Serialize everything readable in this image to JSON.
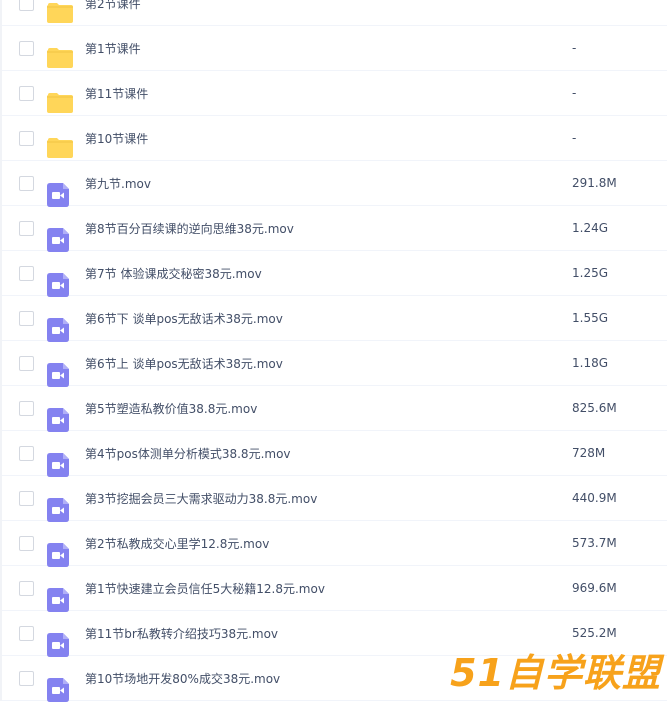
{
  "files": [
    {
      "name": "第2节课件",
      "type": "folder",
      "size": ""
    },
    {
      "name": "第1节课件",
      "type": "folder",
      "size": "-"
    },
    {
      "name": "第11节课件",
      "type": "folder",
      "size": "-"
    },
    {
      "name": "第10节课件",
      "type": "folder",
      "size": "-"
    },
    {
      "name": "第九节.mov",
      "type": "video",
      "size": "291.8M"
    },
    {
      "name": "第8节百分百续课的逆向思维38元.mov",
      "type": "video",
      "size": "1.24G"
    },
    {
      "name": "第7节 体验课成交秘密38元.mov",
      "type": "video",
      "size": "1.25G"
    },
    {
      "name": "第6节下 谈单pos无敌话术38元.mov",
      "type": "video",
      "size": "1.55G"
    },
    {
      "name": "第6节上 谈单pos无敌话术38元.mov",
      "type": "video",
      "size": "1.18G"
    },
    {
      "name": "第5节塑造私教价值38.8元.mov",
      "type": "video",
      "size": "825.6M"
    },
    {
      "name": "第4节pos体测单分析模式38.8元.mov",
      "type": "video",
      "size": "728M"
    },
    {
      "name": "第3节挖掘会员三大需求驱动力38.8元.mov",
      "type": "video",
      "size": "440.9M"
    },
    {
      "name": "第2节私教成交心里学12.8元.mov",
      "type": "video",
      "size": "573.7M"
    },
    {
      "name": "第1节快速建立会员信任5大秘籍12.8元.mov",
      "type": "video",
      "size": "969.6M"
    },
    {
      "name": "第11节br私教转介绍技巧38元.mov",
      "type": "video",
      "size": "525.2M"
    },
    {
      "name": "第10节场地开发80%成交38元.mov",
      "type": "video",
      "size": ""
    }
  ],
  "colors": {
    "folder": "#ffd659",
    "video": "#8482f0",
    "text": "#424e67",
    "watermark": "#f7a21b"
  },
  "watermark": "51自学联盟"
}
